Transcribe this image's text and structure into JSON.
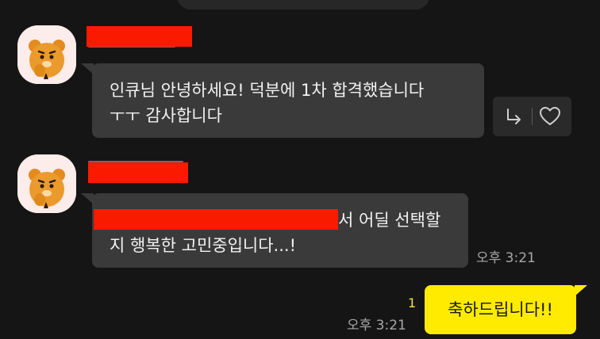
{
  "colors": {
    "background": "#151515",
    "incoming_bubble": "#3a3a3a",
    "outgoing_bubble": "#ffeb00",
    "redaction": "#fa1a00",
    "timestamp": "#a8a8a8",
    "unread": "#f6e04b"
  },
  "messages": [
    {
      "avatar_icon": "ryan-character-icon",
      "lines": [
        "인큐님 안녕하세요! 덕분에 1차 합격했습니다",
        "ㅜㅜ 감사합니다"
      ],
      "actions": {
        "reply_icon": "reply-arrow-icon",
        "like_icon": "heart-icon"
      }
    },
    {
      "avatar_icon": "ryan-character-icon",
      "lines": [
        "서 어딜 선택할",
        "지 행복한 고민중입니다...!"
      ],
      "time": "오후 3:21"
    }
  ],
  "my_message": {
    "text": "축하드립니다!!",
    "unread_count": "1",
    "time": "오후 3:21"
  }
}
